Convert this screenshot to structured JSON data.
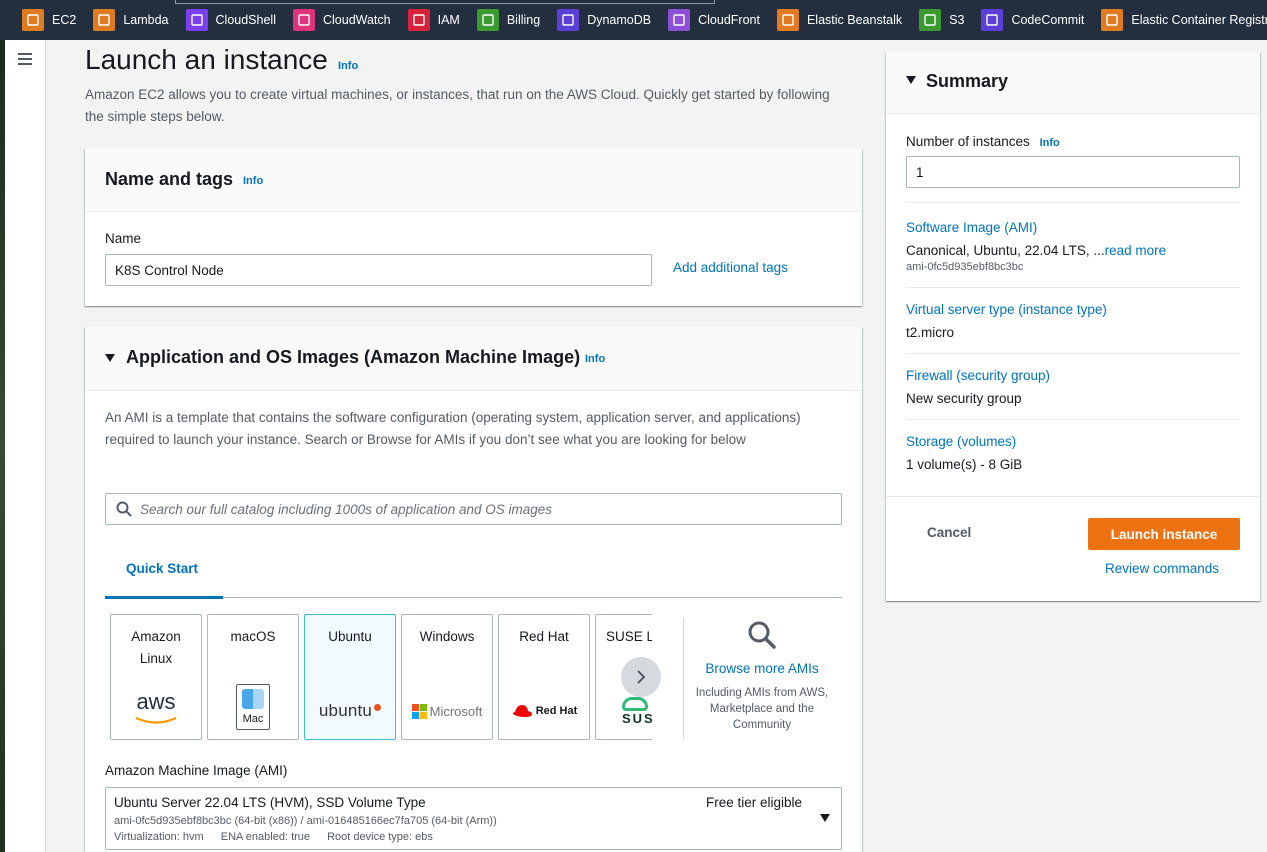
{
  "favorites": [
    {
      "label": "EC2",
      "icon": "ec2-icon",
      "color": "#e07b20"
    },
    {
      "label": "Lambda",
      "icon": "lambda-icon",
      "color": "#e07b20"
    },
    {
      "label": "CloudShell",
      "icon": "cloudshell-icon",
      "color": "#7b3ff2"
    },
    {
      "label": "CloudWatch",
      "icon": "cloudwatch-icon",
      "color": "#e0347a"
    },
    {
      "label": "IAM",
      "icon": "iam-icon",
      "color": "#d8213a"
    },
    {
      "label": "Billing",
      "icon": "billing-icon",
      "color": "#3a9a2f"
    },
    {
      "label": "DynamoDB",
      "icon": "dynamodb-icon",
      "color": "#5b3fd6"
    },
    {
      "label": "CloudFront",
      "icon": "cloudfront-icon",
      "color": "#8c4fd8"
    },
    {
      "label": "Elastic Beanstalk",
      "icon": "elastic-beanstalk-icon",
      "color": "#e07b20"
    },
    {
      "label": "S3",
      "icon": "s3-icon",
      "color": "#3a9a2f"
    },
    {
      "label": "CodeCommit",
      "icon": "codecommit-icon",
      "color": "#5b3fd6"
    },
    {
      "label": "Elastic Container Registry",
      "icon": "ecr-icon",
      "color": "#e07b20"
    }
  ],
  "page": {
    "title": "Launch an instance",
    "info": "Info",
    "intro": "Amazon EC2 allows you to create virtual machines, or instances, that run on the AWS Cloud. Quickly get started by following the simple steps below."
  },
  "name_tags": {
    "title": "Name and tags",
    "info": "Info",
    "name_label": "Name",
    "name_value": "K8S Control Node",
    "add_tags": "Add additional tags"
  },
  "ami": {
    "title": "Application and OS Images (Amazon Machine Image)",
    "info": "Info",
    "description": "An AMI is a template that contains the software configuration (operating system, application server, and applications) required to launch your instance. Search or Browse for AMIs if you don’t see what you are looking for below",
    "search_placeholder": "Search our full catalog including 1000s of application and OS images",
    "tab_quick_start": "Quick Start",
    "tiles": [
      {
        "name": "Amazon Linux",
        "logo_text": "aws"
      },
      {
        "name": "macOS",
        "logo_text": "Mac"
      },
      {
        "name": "Ubuntu",
        "logo_text": "ubuntu"
      },
      {
        "name": "Windows",
        "logo_text": "Microsoft"
      },
      {
        "name": "Red Hat",
        "logo_text": "Red Hat"
      },
      {
        "name": "SUSE Li",
        "logo_text": "SUS"
      }
    ],
    "selected_tile": "Ubuntu",
    "browse_link": "Browse more AMIs",
    "browse_sub": "Including AMIs from AWS, Marketplace and the Community",
    "ami_label": "Amazon Machine Image (AMI)",
    "selected_ami": {
      "name": "Ubuntu Server 22.04 LTS (HVM), SSD Volume Type",
      "badge": "Free tier eligible",
      "ids": "ami-0fc5d935ebf8bc3bc (64-bit (x86)) / ami-016485166ec7fa705 (64-bit (Arm))",
      "virtualization": "Virtualization: hvm",
      "ena": "ENA enabled: true",
      "root_device": "Root device type: ebs"
    }
  },
  "summary": {
    "title": "Summary",
    "num_label": "Number of instances",
    "info": "Info",
    "num_value": "1",
    "software_label": "Software Image (AMI)",
    "software_value": "Canonical, Ubuntu, 22.04 LTS, ...",
    "read_more": "read more",
    "software_id": "ami-0fc5d935ebf8bc3bc",
    "type_label": "Virtual server type (instance type)",
    "type_value": "t2.micro",
    "firewall_label": "Firewall (security group)",
    "firewall_value": "New security group",
    "storage_label": "Storage (volumes)",
    "storage_value": "1 volume(s) - 8 GiB",
    "cancel": "Cancel",
    "launch": "Launch instance",
    "review": "Review commands"
  }
}
